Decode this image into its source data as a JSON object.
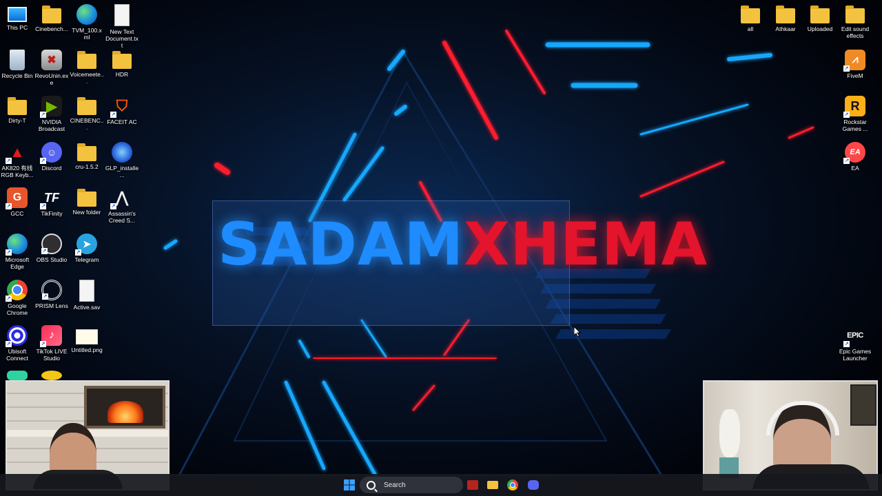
{
  "wallpaper": {
    "banner_part1": "SADAM",
    "banner_part2": "XHEMA",
    "color_part1": "#1e8bff",
    "color_part2": "#e3142b"
  },
  "desktop_left": [
    {
      "label": "This PC",
      "icon": "pc-icon"
    },
    {
      "label": "Cinebench...",
      "icon": "folder-icon"
    },
    {
      "label": "TVM_100.xml",
      "icon": "edge-icon"
    },
    {
      "label": "New Text Document.txt",
      "icon": "document-icon"
    },
    {
      "label": "Recycle Bin",
      "icon": "recycle-bin-icon"
    },
    {
      "label": "RevoUnin.exe",
      "icon": "revo-uninstaller-icon"
    },
    {
      "label": "Voicemeete...",
      "icon": "folder-icon"
    },
    {
      "label": "HDR",
      "icon": "folder-icon"
    },
    {
      "label": "Dirty-T",
      "icon": "folder-icon"
    },
    {
      "label": "NVIDIA Broadcast",
      "icon": "nvidia-icon"
    },
    {
      "label": "CINEBENC...",
      "icon": "folder-icon"
    },
    {
      "label": "FACEIT AC",
      "icon": "faceit-icon"
    },
    {
      "label": "AK820 有线 RGB Keyb...",
      "icon": "keyboard-app-icon"
    },
    {
      "label": "Discord",
      "icon": "discord-icon"
    },
    {
      "label": "cru-1.5.2",
      "icon": "folder-icon"
    },
    {
      "label": "GLP_installe...",
      "icon": "glp-installer-icon"
    },
    {
      "label": "GCC",
      "icon": "gcc-icon"
    },
    {
      "label": "TikFinity",
      "icon": "tikfinity-icon"
    },
    {
      "label": "New folder",
      "icon": "folder-icon"
    },
    {
      "label": "Assassin's Creed S...",
      "icon": "assassins-creed-icon"
    },
    {
      "label": "Microsoft Edge",
      "icon": "edge-icon"
    },
    {
      "label": "OBS Studio",
      "icon": "obs-icon"
    },
    {
      "label": "Telegram",
      "icon": "telegram-icon"
    },
    {
      "label": "",
      "icon": ""
    },
    {
      "label": "Google Chrome",
      "icon": "chrome-icon"
    },
    {
      "label": "PRISM Lens",
      "icon": "prism-lens-icon"
    },
    {
      "label": "Active.sav",
      "icon": "document-icon"
    },
    {
      "label": "",
      "icon": ""
    },
    {
      "label": "Ubisoft Connect",
      "icon": "ubisoft-icon"
    },
    {
      "label": "TikTok LIVE Studio",
      "icon": "tiktok-icon"
    },
    {
      "label": "Untitled.png",
      "icon": "image-file-icon"
    }
  ],
  "desktop_right": [
    {
      "label": "all",
      "icon": "folder-icon"
    },
    {
      "label": "Athkaar",
      "icon": "folder-icon"
    },
    {
      "label": "Uploaded",
      "icon": "folder-icon"
    },
    {
      "label": "Edit sound effects",
      "icon": "folder-icon"
    },
    {
      "label": "FiveM",
      "icon": "fivem-icon"
    },
    {
      "label": "Rockstar Games ...",
      "icon": "rockstar-icon"
    },
    {
      "label": "EA",
      "icon": "ea-icon"
    },
    {
      "label": "Epic Games Launcher",
      "icon": "epic-games-icon"
    }
  ],
  "icon_glyphs": {
    "epic": "EPIC",
    "ea": "EA",
    "rockstar": "R",
    "tikfinity": "TF"
  },
  "taskbar": {
    "search_placeholder": "Search"
  }
}
